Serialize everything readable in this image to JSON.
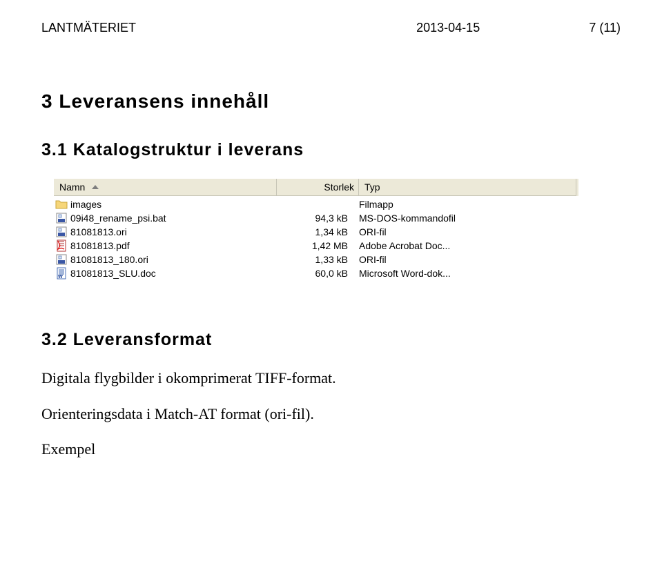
{
  "header": {
    "left": "LANTMÄTERIET",
    "center": "2013-04-15",
    "right": "7 (11)"
  },
  "section3": {
    "title": "3 Leveransens innehåll",
    "sub1": {
      "title": "3.1 Katalogstruktur i leverans",
      "listing": {
        "headers": {
          "name": "Namn",
          "size": "Storlek",
          "type": "Typ"
        },
        "rows": [
          {
            "icon": "folder",
            "name": "images",
            "size": "",
            "type": "Filmapp"
          },
          {
            "icon": "bat",
            "name": "09i48_rename_psi.bat",
            "size": "94,3 kB",
            "type": "MS-DOS-kommandofil"
          },
          {
            "icon": "ori",
            "name": "81081813.ori",
            "size": "1,34 kB",
            "type": "ORI-fil"
          },
          {
            "icon": "pdf",
            "name": "81081813.pdf",
            "size": "1,42 MB",
            "type": "Adobe Acrobat Doc..."
          },
          {
            "icon": "ori",
            "name": "81081813_180.ori",
            "size": "1,33 kB",
            "type": "ORI-fil"
          },
          {
            "icon": "doc",
            "name": "81081813_SLU.doc",
            "size": "60,0 kB",
            "type": "Microsoft Word-dok..."
          }
        ]
      }
    },
    "sub2": {
      "title": "3.2 Leveransformat",
      "p1": "Digitala flygbilder i okomprimerat TIFF-format.",
      "p2": "Orienteringsdata i Match-AT format (ori-fil).",
      "p3": "Exempel"
    }
  }
}
